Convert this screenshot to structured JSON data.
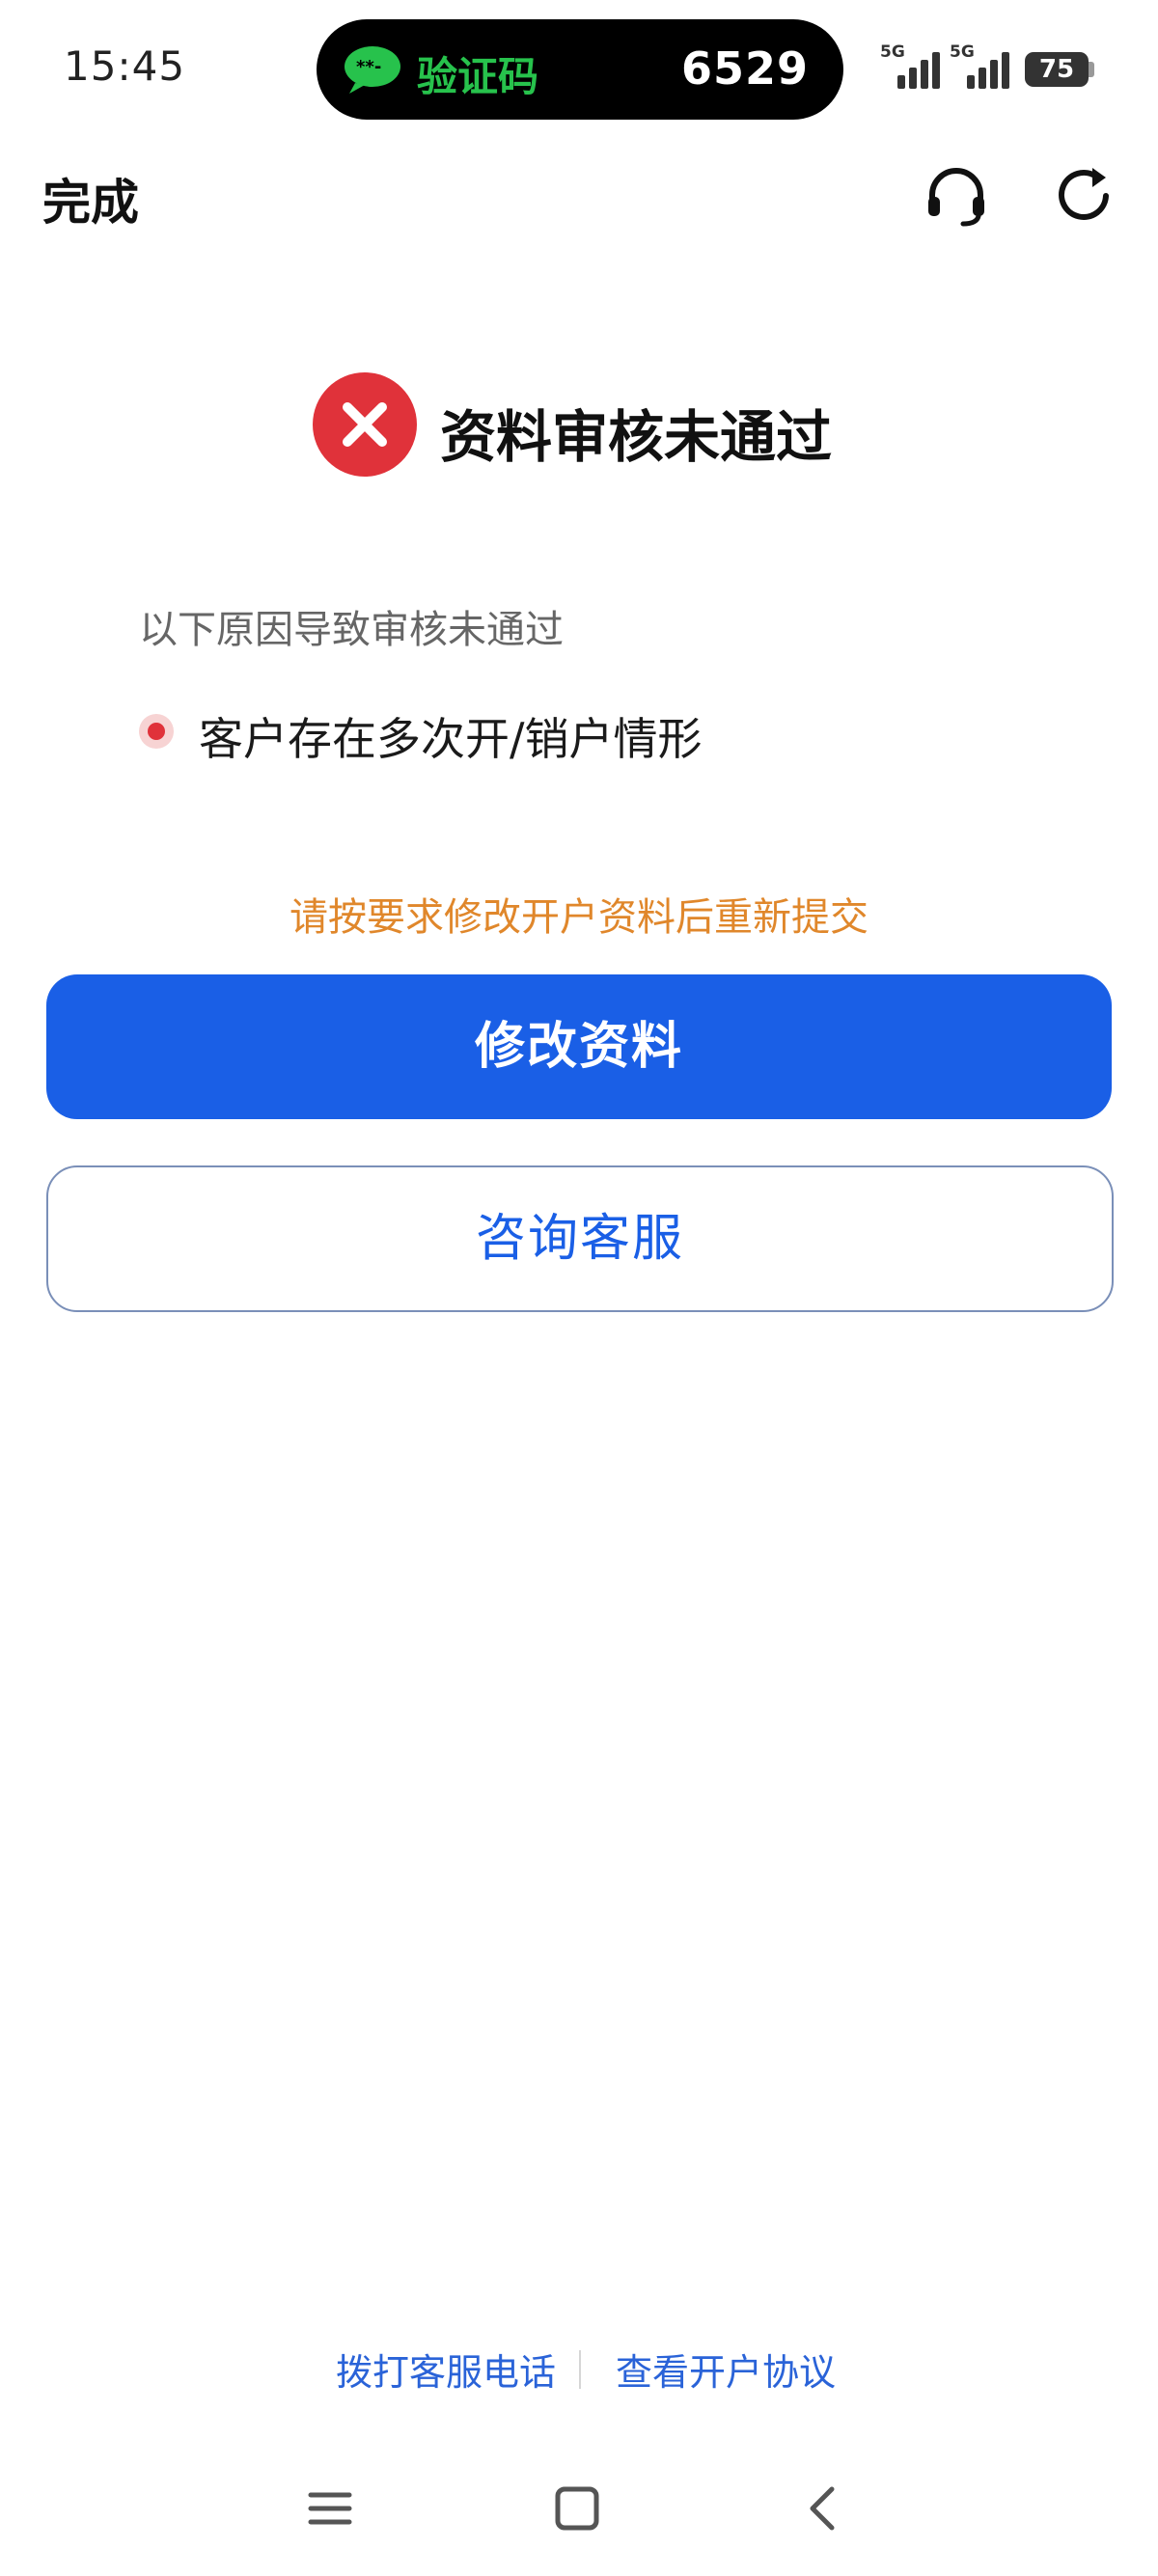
{
  "status_bar": {
    "time": "15:45",
    "sms": {
      "title": "验证码",
      "code": "6529"
    },
    "network_1": "5G",
    "network_2": "5G",
    "battery": "75"
  },
  "top_bar": {
    "done_label": "完成"
  },
  "result": {
    "title": "资料审核未通过",
    "reason_label": "以下原因导致审核未通过",
    "reasons": [
      "客户存在多次开/销户情形"
    ],
    "hint": "请按要求修改开户资料后重新提交"
  },
  "actions": {
    "primary_label": "修改资料",
    "secondary_label": "咨询客服"
  },
  "footer": {
    "call_label": "拨打客服电话",
    "agreement_label": "查看开户协议"
  },
  "colors": {
    "primary": "#1a5fe6",
    "error": "#e0323a",
    "hint": "#e0872b",
    "sms_green": "#27c24c"
  },
  "icons": [
    "headset-icon",
    "refresh-icon",
    "error-icon",
    "sms-icon",
    "menu-icon",
    "home-icon",
    "back-icon"
  ]
}
